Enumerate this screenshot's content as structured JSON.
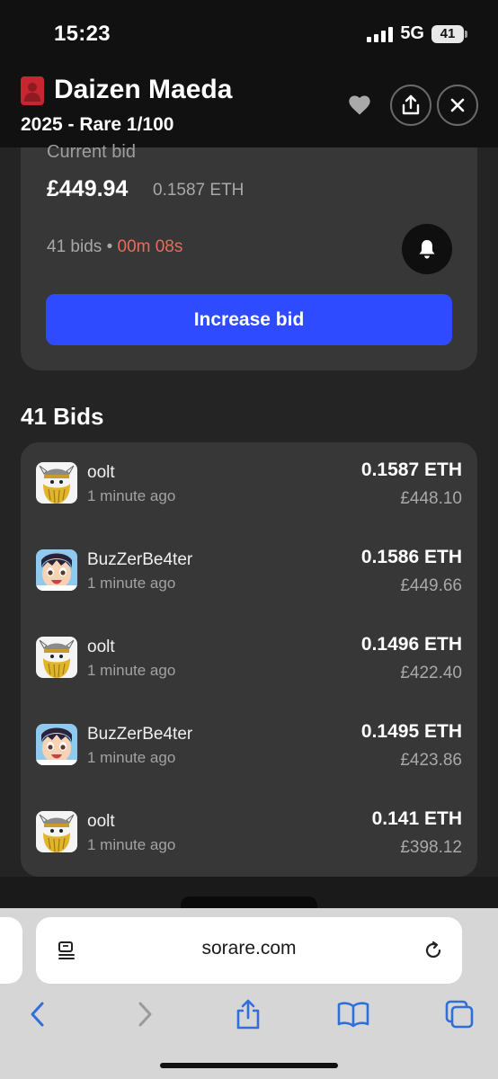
{
  "status_bar": {
    "time": "15:23",
    "network": "5G",
    "battery": "41"
  },
  "header": {
    "player_name": "Daizen Maeda",
    "card_subtitle": "2025 - Rare 1/100"
  },
  "auction": {
    "current_bid_label": "Current bid",
    "price_gbp": "£449.94",
    "price_eth": "0.1587 ETH",
    "bid_count": "41 bids",
    "separator": "•",
    "time_left": "00m 08s",
    "increase_bid_label": "Increase bid"
  },
  "bids": {
    "heading": "41 Bids",
    "items": [
      {
        "user": "oolt",
        "time": "1 minute ago",
        "eth": "0.1587 ETH",
        "gbp": "£448.10",
        "avatar": "viking-avatar"
      },
      {
        "user": "BuzZerBe4ter",
        "time": "1 minute ago",
        "eth": "0.1586 ETH",
        "gbp": "£449.66",
        "avatar": "anime-boy-avatar"
      },
      {
        "user": "oolt",
        "time": "1 minute ago",
        "eth": "0.1496 ETH",
        "gbp": "£422.40",
        "avatar": "viking-avatar"
      },
      {
        "user": "BuzZerBe4ter",
        "time": "1 minute ago",
        "eth": "0.1495 ETH",
        "gbp": "£423.86",
        "avatar": "anime-boy-avatar"
      },
      {
        "user": "oolt",
        "time": "1 minute ago",
        "eth": "0.141 ETH",
        "gbp": "£398.12",
        "avatar": "viking-avatar"
      }
    ]
  },
  "browser": {
    "url": "sorare.com"
  },
  "colors": {
    "accent": "#2f4bff",
    "timer": "#ea6b5a",
    "card_red": "#c72630"
  }
}
